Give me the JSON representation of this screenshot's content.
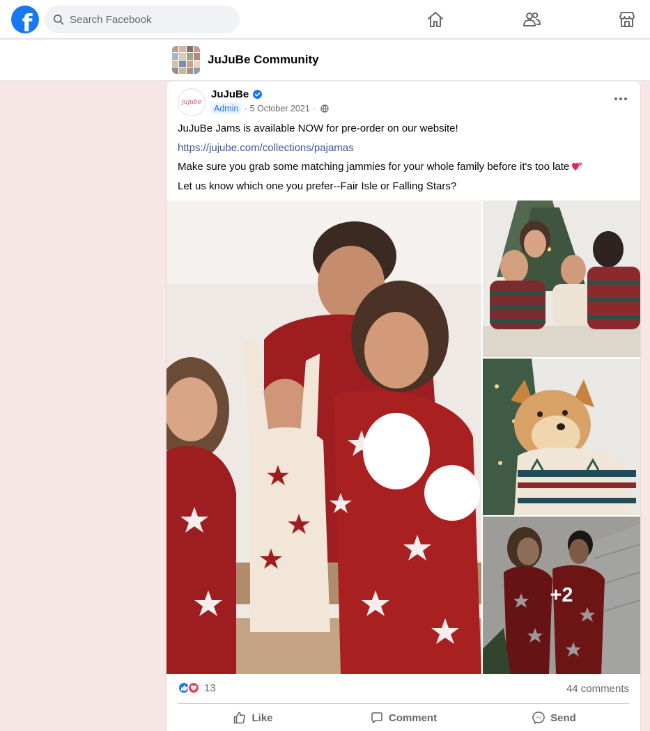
{
  "topbar": {
    "logo_letter": "f",
    "search_placeholder": "Search Facebook",
    "nav": [
      "home-icon",
      "groups-icon",
      "marketplace-icon"
    ]
  },
  "group": {
    "name": "JuJuBe Community"
  },
  "post": {
    "author": "JuJuBe",
    "avatar_text": "jujube",
    "badge": "Admin",
    "date": "5 October 2021",
    "separator": "·",
    "lines": [
      "JuJuBe Jams is available NOW for pre-order on our website!",
      "https://jujube.com/collections/pajamas",
      "Make sure you grab some matching jammies for your whole family before it's too late",
      "Let us know which one you prefer--Fair Isle or Falling Stars?"
    ],
    "more_photos": "+2",
    "reactions_count": "13",
    "comments": "44 comments",
    "actions": {
      "like": "Like",
      "comment": "Comment",
      "send": "Send"
    }
  },
  "colors": {
    "brand": "#1877f2",
    "page_bg": "#f6e6e6",
    "pajama_red": "#9e1d21"
  }
}
